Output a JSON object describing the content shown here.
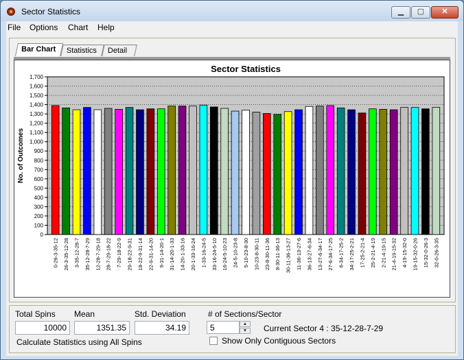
{
  "window": {
    "title": "Sector Statistics",
    "min_label": "▁",
    "max_label": "▢",
    "close_label": "✕"
  },
  "menu": {
    "items": [
      "File",
      "Options",
      "Chart",
      "Help"
    ]
  },
  "tabs": [
    {
      "label": "Bar Chart",
      "active": true
    },
    {
      "label": "Statistics",
      "active": false
    },
    {
      "label": "Detail",
      "active": false
    }
  ],
  "chart_data": {
    "type": "bar",
    "title": "Sector Statistics",
    "xlabel": "",
    "ylabel": "No. of Outcomes",
    "ylim": [
      0,
      1700
    ],
    "ytick_step": 100,
    "grid": true,
    "categories": [
      "0-26-3-35-12",
      "26-3-35-12-28",
      "3-35-12-28-7",
      "35-12-28-7-29",
      "12-28-7-29-18",
      "28-7-29-18-22",
      "7-29-18-22-9",
      "29-18-22-9-31",
      "18-22-9-31-14",
      "22-9-31-14-20",
      "9-31-14-20-1",
      "31-14-20-1-33",
      "14-20-1-33-16",
      "20-1-33-16-24",
      "1-33-16-24-5",
      "33-16-24-5-10",
      "16-24-5-10-23",
      "24-5-10-23-8",
      "5-10-23-8-30",
      "10-23-8-30-11",
      "23-8-30-11-36",
      "8-30-11-36-13",
      "30-11-36-13-27",
      "11-36-13-27-6",
      "36-13-27-6-34",
      "13-27-6-34-17",
      "27-6-34-17-25",
      "6-34-17-25-2",
      "34-17-25-2-21",
      "17-25-2-21-4",
      "25-2-21-4-19",
      "2-21-4-19-15",
      "21-4-19-15-32",
      "4-19-15-32-0",
      "19-15-32-0-26",
      "15-32-0-26-3",
      "32-0-26-3-35"
    ],
    "values": [
      1390,
      1365,
      1345,
      1370,
      1345,
      1360,
      1350,
      1370,
      1345,
      1355,
      1355,
      1385,
      1385,
      1385,
      1395,
      1375,
      1360,
      1330,
      1340,
      1320,
      1305,
      1295,
      1325,
      1345,
      1380,
      1385,
      1390,
      1365,
      1345,
      1310,
      1355,
      1350,
      1345,
      1370,
      1370,
      1355,
      1370
    ],
    "colors": [
      "#ff0000",
      "#008000",
      "#ffff00",
      "#0000ff",
      "#ffffff",
      "#808080",
      "#ff00ff",
      "#008080",
      "#000080",
      "#800000",
      "#00ff00",
      "#808000",
      "#800080",
      "#c0c0c0",
      "#00ffff",
      "#000000",
      "#c0dcc0",
      "#a6caf0",
      "#ffffff",
      "#a0a0a4",
      "#ff0000",
      "#008000",
      "#ffff00",
      "#0000ff",
      "#ffffff",
      "#808080",
      "#ff00ff",
      "#008080",
      "#000080",
      "#800000",
      "#00ff00",
      "#808000",
      "#800080",
      "#c0c0c0",
      "#00ffff",
      "#000000",
      "#c0dcc0"
    ],
    "plot_bg": "#c8c8c8"
  },
  "stats": {
    "total_spins_label": "Total Spins",
    "total_spins": "10000",
    "mean_label": "Mean",
    "mean": "1351.35",
    "std_label": "Std. Deviation",
    "std": "34.19",
    "sections_label": "# of Sections/Sector",
    "sections": "5",
    "current_sector": "Current Sector 4 : 35-12-28-7-29",
    "calc_note": "Calculate Statistics using All Spins",
    "contiguous_label": "Show Only Contiguous Sectors",
    "contiguous_checked": false
  }
}
